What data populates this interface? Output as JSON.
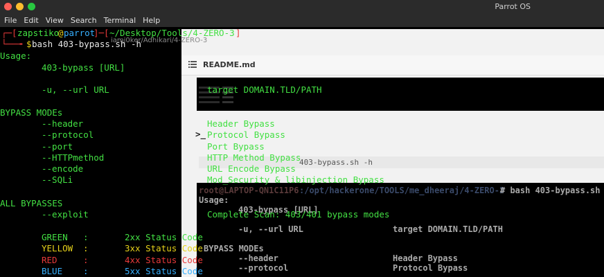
{
  "window": {
    "title": "Parrot OS"
  },
  "menu": [
    "File",
    "Edit",
    "View",
    "Search",
    "Terminal",
    "Help"
  ],
  "prompt": {
    "user": "zapstiko",
    "at": "@",
    "host": "parrot",
    "path": "~/Desktop/Tools/4-ZERO-3",
    "command": "bash 403-bypass.sh -h",
    "dollar": "$"
  },
  "left": {
    "usage": "Usage:",
    "usage_line": "403-bypass [URL]",
    "url_opt": "-u, --url URL",
    "modes_head": "BYPASS MODEs",
    "modes": [
      "--header",
      "--protocol",
      "--port",
      "--HTTPmethod",
      "--encode",
      "--SQLi"
    ],
    "all_head": "ALL BYPASSES",
    "exploit": "--exploit",
    "legend": [
      {
        "name": "GREEN",
        "sep": ":",
        "code": "2xx Status Code"
      },
      {
        "name": "YELLOW",
        "sep": ":",
        "code": "3xx Status Code"
      },
      {
        "name": "RED",
        "sep": ":",
        "code": "4xx Status Code"
      },
      {
        "name": "BLUE",
        "sep": ":",
        "code": "5xx Status Code"
      }
    ]
  },
  "right": {
    "target": "target DOMAIN.TLD/PATH",
    "modes": [
      "Header Bypass",
      "Protocol Bypass",
      "Port Bypass",
      "HTTP Method Bypass",
      "URL Encode Bypass",
      "Mod_Security & libinjection Bypass"
    ],
    "complete": "Complete Scan: 403/401 bypass modes"
  },
  "background": {
    "ghost_path": "iamj0ker/Adhikari/4-ZERO-3",
    "readme": "README.md",
    "cmd_fragment": "403-bypass.sh -h",
    "term_prompt_user": "root@LAPTOP-QN1C11P6",
    "term_prompt_path": ":/opt/hackerone/TOOLS/me_dheeraj/4-ZERO-3",
    "term_prompt_cmd": "# bash 403-bypass.sh -h",
    "t_usage": "Usage:",
    "t_usage_line": "403-bypass [URL]",
    "t_url": "-u, --url URL",
    "t_target": "target DOMAIN.TLD/PATH",
    "t_modes_head": "BYPASS MODEs",
    "t_header": "--header",
    "t_header_desc": "Header Bypass",
    "t_protocol": "--protocol",
    "t_protocol_desc": "Protocol Bypass"
  }
}
